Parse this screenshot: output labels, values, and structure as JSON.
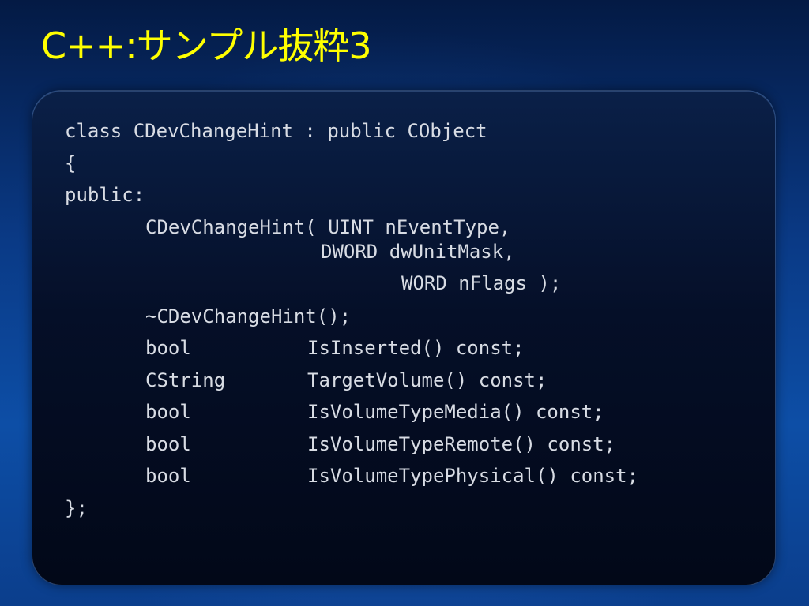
{
  "slide": {
    "title": "C++:サンプル抜粋3"
  },
  "code": {
    "lines": [
      "class CDevChangeHint : public CObject",
      "{",
      "public:",
      "CDevChangeHint( UINT nEventType,",
      "DWORD dwUnitMask,",
      "WORD nFlags );",
      "~CDevChangeHint();",
      "bool",
      "IsInserted() const;",
      "CString",
      "TargetVolume() const;",
      "bool",
      "IsVolumeTypeMedia() const;",
      "bool",
      "IsVolumeTypeRemote() const;",
      "bool",
      "IsVolumeTypePhysical() const;",
      "};"
    ]
  }
}
